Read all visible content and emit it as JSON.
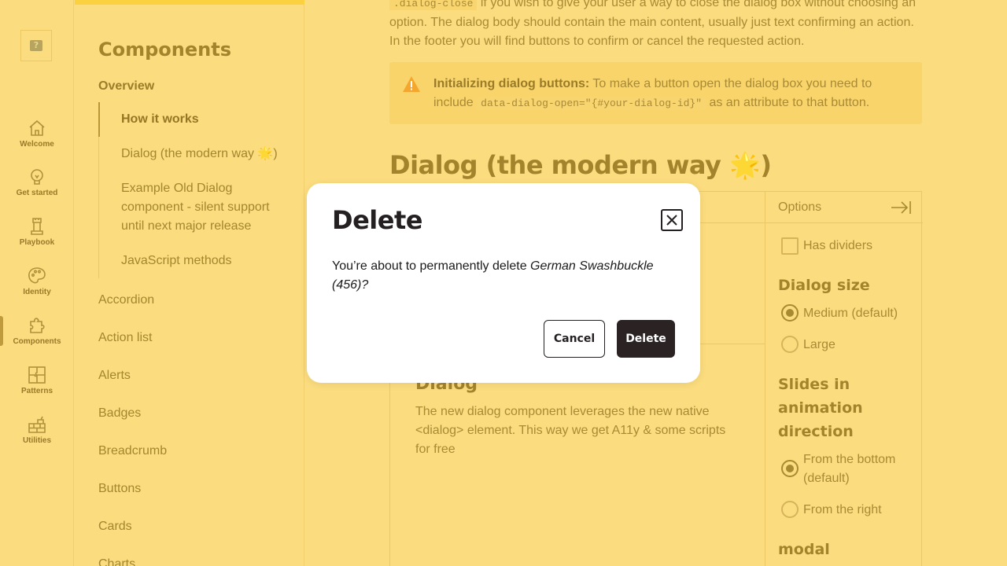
{
  "rail": {
    "items": [
      {
        "label": "Welcome",
        "icon": "home-icon"
      },
      {
        "label": "Get started",
        "icon": "lightbulb-icon"
      },
      {
        "label": "Playbook",
        "icon": "rook-icon"
      },
      {
        "label": "Identity",
        "icon": "palette-icon"
      },
      {
        "label": "Components",
        "icon": "puzzle-icon"
      },
      {
        "label": "Patterns",
        "icon": "jigsaw-icon"
      },
      {
        "label": "Utilities",
        "icon": "bricks-icon"
      }
    ],
    "active": "Components"
  },
  "nav": {
    "title": "Components",
    "overview": "Overview",
    "sub_items": [
      {
        "label": "How it works"
      },
      {
        "label": "Dialog (the modern way 🌟)"
      },
      {
        "label": "Example Old Dialog component - silent support until next major release"
      },
      {
        "label": "JavaScript methods"
      }
    ],
    "items": [
      "Accordion",
      "Action list",
      "Alerts",
      "Badges",
      "Breadcrumb",
      "Buttons",
      "Cards",
      "Charts"
    ]
  },
  "main": {
    "intro_code": ".dialog-close",
    "intro_after": " if you wish to give your user a way to close the dialog box without choosing an option. The dialog body should contain the main content, usually just text confirming an action. In the footer you will find buttons to confirm or cancel the requested action.",
    "callout": {
      "title": "Initializing dialog buttons:",
      "text_before": " To make a button open the dialog box you need to include ",
      "code": "data-dialog-open=\"{#your-dialog-id}\"",
      "text_after": " as an attribute to that button."
    },
    "section_heading": "Dialog (the modern way 🌟)",
    "demo": {
      "card_title": "Dialog",
      "card_text": "The new dialog component leverages the new native <dialog> element. This way we get A11y & some scripts for free"
    },
    "options": {
      "title": "Options",
      "has_dividers": "Has dividers",
      "size_heading": "Dialog size",
      "size_medium": "Medium (default)",
      "size_large": "Large",
      "slide_heading": "Slides in animation direction",
      "slide_bottom": "From the bottom (default)",
      "slide_right": "From the right",
      "modal_heading": "modal"
    }
  },
  "dialog": {
    "title": "Delete",
    "body_prefix": "You’re about to permanently delete ",
    "body_item": "German Swashbuckle (456)?",
    "cancel_label": "Cancel",
    "delete_label": "Delete"
  },
  "colors": {
    "overlay_bg": "#fbdc7e",
    "accent": "#fcd13f",
    "dialog_bg": "#ffffff",
    "primary_button": "#2b2224"
  }
}
